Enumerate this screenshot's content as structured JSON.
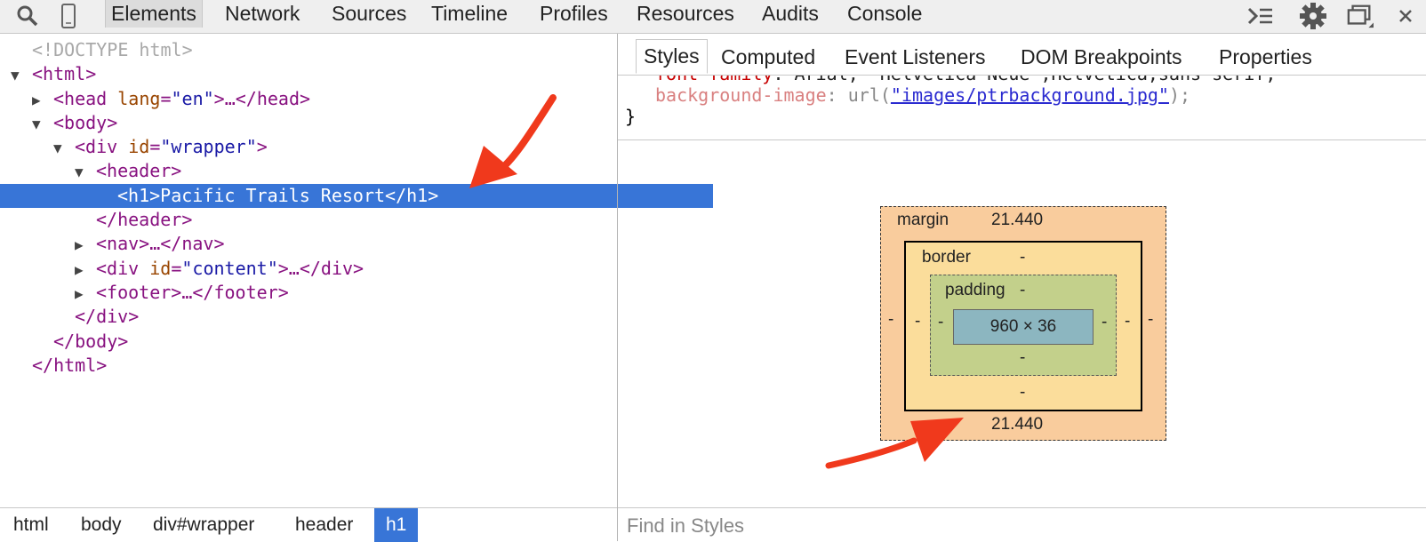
{
  "toolbar": {
    "icons": [
      "search-icon",
      "device-mode-icon"
    ],
    "tabs": [
      "Elements",
      "Network",
      "Sources",
      "Timeline",
      "Profiles",
      "Resources",
      "Audits",
      "Console"
    ],
    "active_tab": "Elements",
    "right_icons": [
      "console-drawer-icon",
      "gear-icon",
      "dock-icon",
      "close-icon"
    ]
  },
  "dom_tree": {
    "doctype": "<!DOCTYPE html>",
    "html_open": "<html>",
    "head_tag": "head",
    "head_attr": "lang",
    "head_val": "\"en\"",
    "head_rest": ">…</head>",
    "body_open": "<body>",
    "div_tag": "div",
    "div_attr": "id",
    "div_val": "\"wrapper\"",
    "header_open": "<header>",
    "h1_selected": "<h1>Pacific Trails Resort</h1>",
    "header_close": "</header>",
    "nav": "<nav>…</nav>",
    "content_tag": "div",
    "content_attr": "id",
    "content_val": "\"content\"",
    "content_rest": ">…</div>",
    "footer": "<footer>…</footer>",
    "div_close": "</div>",
    "body_close": "</body>",
    "html_close": "</html>"
  },
  "breadcrumbs": [
    "html",
    "body",
    "div#wrapper",
    "header",
    "h1"
  ],
  "breadcrumb_active": "h1",
  "sidebar": {
    "tabs": [
      "Styles",
      "Computed",
      "Event Listeners",
      "DOM Breakpoints",
      "Properties"
    ],
    "active_tab": "Styles",
    "css": {
      "partial_prop": "font-family",
      "partial_value": ": Arial, \"Helvetica Neue\",Helvetica,sans-serif;",
      "prop": "background-image",
      "colon": ": url(",
      "url": "\"images/ptrbackground.jpg\"",
      "close": ");",
      "brace": "}"
    },
    "box_model": {
      "margin_label": "margin",
      "margin_top": "21.440",
      "margin_bottom": "21.440",
      "margin_left": "-",
      "margin_right": "-",
      "border_label": "border",
      "border_top": "-",
      "border_bottom": "-",
      "border_left": "-",
      "border_right": "-",
      "padding_label": "padding",
      "padding_top": "-",
      "padding_bottom": "-",
      "padding_left": "-",
      "padding_right": "-",
      "content": "960 × 36"
    },
    "find_placeholder": "Find in Styles"
  },
  "colors": {
    "selection": "#3875d7",
    "annotation_arrow": "#f0391c"
  }
}
